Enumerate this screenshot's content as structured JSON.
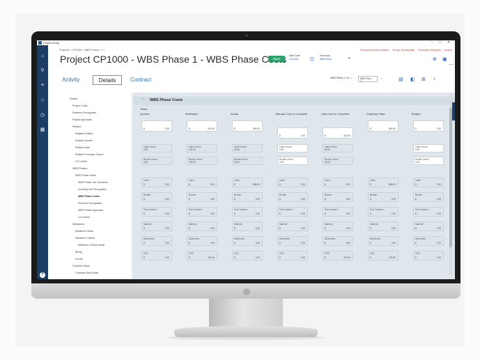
{
  "titlebar": {
    "app_name": "Project Entry",
    "controls": [
      "–",
      "□",
      "✕"
    ]
  },
  "rail": {
    "icons": [
      "home-icon",
      "search-icon",
      "menu-icon",
      "star-icon",
      "history-icon",
      "apps-icon",
      "help-icon"
    ]
  },
  "breadcrumb": "Projects  ›  CP1000  ›  WBS Phase  ›  1  ›",
  "header_links": [
    "Recommended Actions",
    "Group Homepage",
    "Executive Reports",
    "Action"
  ],
  "page_title": "Project CP1000 - WBS Phase 1 - WBS Phase Costs",
  "status_badge": "Open",
  "meta": {
    "start_label": "Start Date",
    "start_value": "1/1/2020",
    "summary_label": "Summary",
    "summary_value": "WBS Entry"
  },
  "tabs": {
    "activity": "Activity",
    "details": "Details",
    "contract": "Contract"
  },
  "toolbar": {
    "label": "WBS Phase 1 of 1",
    "select_value": "WBS Pha...",
    "select_sub": "1"
  },
  "tree": [
    "Details",
    "Project Costs",
    "Revenue Recognition",
    "Project Approvals",
    "Related",
    "Related Entities",
    "Related Quotes",
    "Related Jobs",
    "Related Purchase Orders",
    "UJ Control",
    "WBS Phases",
    "WBS Phase Detail",
    "WBS Phase Job Operation",
    "Invoicing and Recognition",
    "WBS Phase Costs",
    "Revenue Recognition",
    "WBS Phase Approvals",
    "UJ Control",
    "Milestones",
    "Milestone Detail",
    "Milestone Criteria",
    "Milestone Criteria Detail",
    "Billing",
    "Invoice",
    "Checklist Tasks",
    "Checklist Task Detail"
  ],
  "panel": {
    "title": "WBS Phase Costs",
    "section_totals": "Totals"
  },
  "columns": [
    "Quoted",
    "Estimated",
    "Actual",
    "Manual Cost to Complete",
    "Calc Cost to Complete",
    "Projected Total",
    "Budget"
  ],
  "totals_row": [
    {
      "currency": "$",
      "value": "0.00"
    },
    {
      "currency": "$",
      "value": "200.00"
    },
    {
      "currency": "$",
      "value": "880.00"
    },
    {
      "currency": "$",
      "value": "0.00"
    },
    {
      "currency": "$",
      "value": "220.00"
    },
    {
      "currency": "$",
      "value": "880.00"
    },
    {
      "currency": "$",
      "value": "0.00"
    }
  ],
  "hours_rows": [
    {
      "label": "Labor Hours",
      "values": [
        "0.00",
        "100.00",
        "34.00",
        "0.00",
        "56.00",
        "",
        "0.00"
      ]
    },
    {
      "label": "Burden Hours",
      "values": [
        "0.00",
        "100.00",
        "33.00",
        "0.00",
        "56.00",
        "",
        "0.00"
      ]
    }
  ],
  "cost_rows": [
    {
      "label": "Labor",
      "values": [
        "0.00",
        "0.00",
        "880.00",
        "0.00",
        "0.00",
        "880.00",
        "0.00"
      ]
    },
    {
      "label": "Burden",
      "values": [
        "0.00",
        "0.00",
        "0.00",
        "0.00",
        "0.00",
        "0.00",
        "0.00"
      ]
    },
    {
      "label": "Sub Contract",
      "values": [
        "0.00",
        "0.00",
        "0.00",
        "0.00",
        "0.00",
        "0.00",
        "0.00"
      ]
    },
    {
      "label": "Material",
      "values": [
        "0.00",
        "0.00",
        "0.00",
        "0.00",
        "0.00",
        "0.00",
        "0.00"
      ]
    },
    {
      "label": "Mtl Burden",
      "values": [
        "0.00",
        "0.00",
        "0.00",
        "0.00",
        "0.00",
        "0.00",
        "0.00"
      ]
    },
    {
      "label": "ODC",
      "values": [
        "0.00",
        "220.00",
        "0.00",
        "0.00",
        "220.00",
        "220.00",
        "0.00"
      ]
    }
  ]
}
